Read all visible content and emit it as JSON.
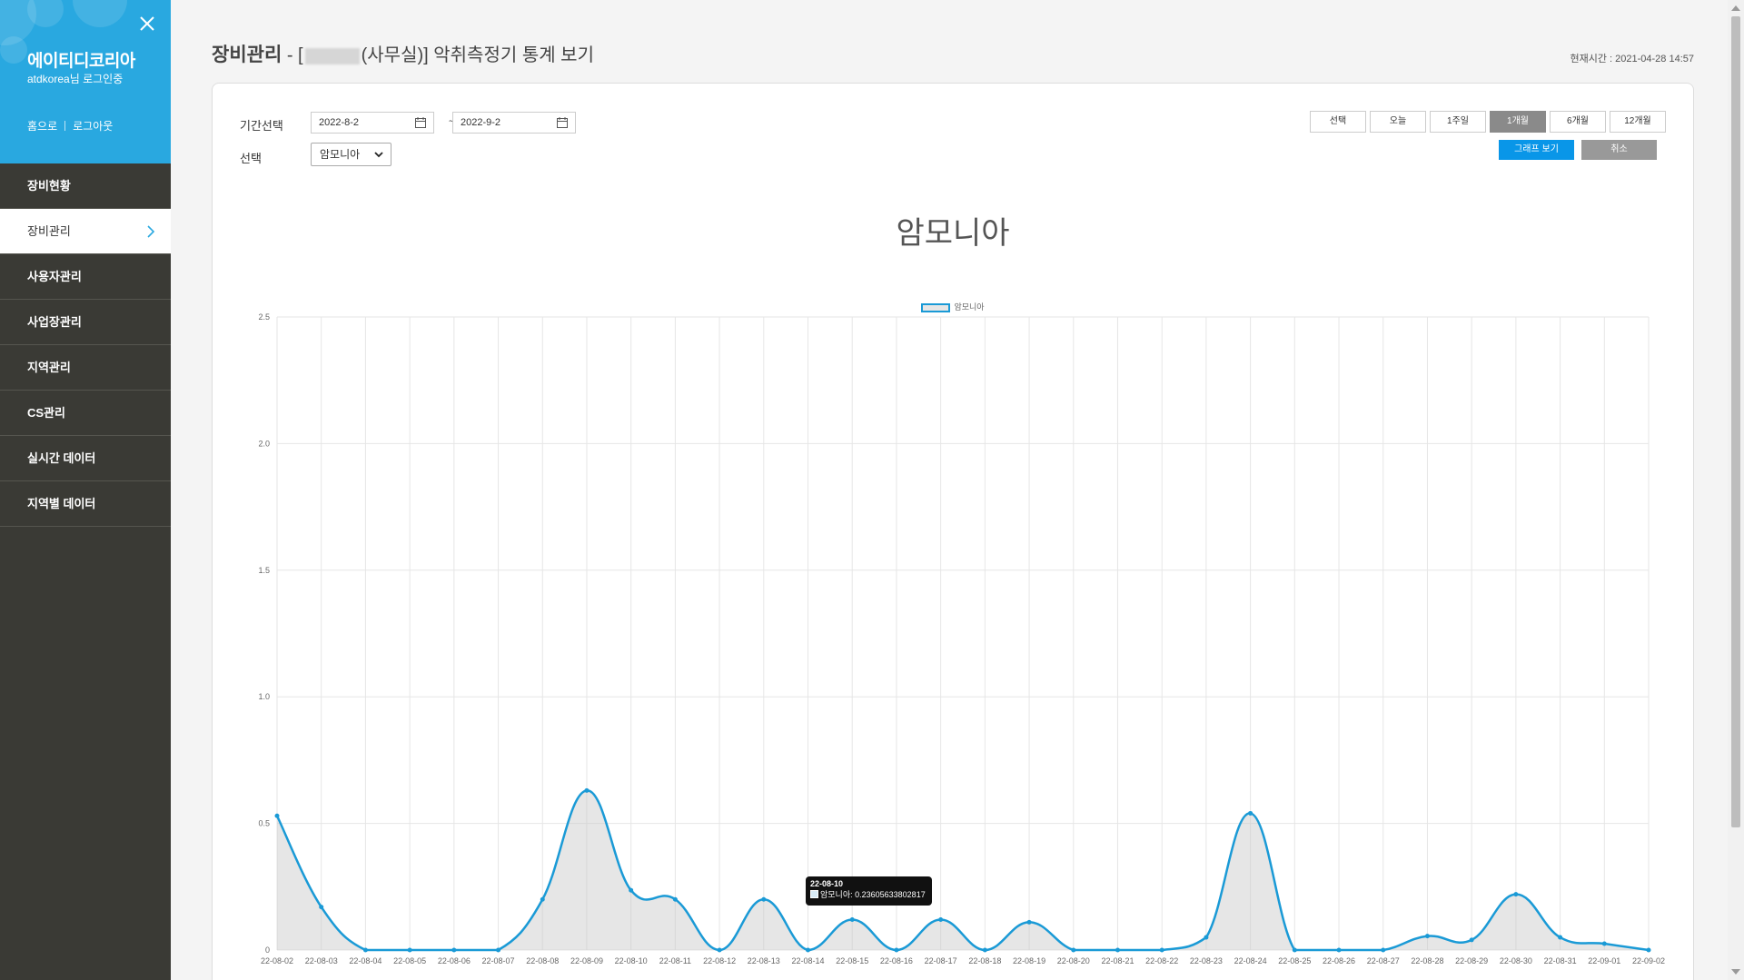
{
  "sidebar": {
    "brand": "에이티디코리아",
    "login_info": "atdkorea님 로그인중",
    "links": [
      "홈으로",
      "로그아웃"
    ],
    "items": [
      {
        "label": "장비현황",
        "active": false
      },
      {
        "label": "장비관리",
        "active": true
      },
      {
        "label": "사용자관리",
        "active": false
      },
      {
        "label": "사업장관리",
        "active": false
      },
      {
        "label": "지역관리",
        "active": false
      },
      {
        "label": "CS관리",
        "active": false
      },
      {
        "label": "실시간 데이터",
        "active": false
      },
      {
        "label": "지역별 데이터",
        "active": false
      }
    ]
  },
  "header": {
    "title_strong": "장비관리",
    "title_prefix": " - [",
    "title_suffix": "(사무실)] 악취측정기 통계 보기",
    "clock": "현재시간 : 2021-04-28 14:57"
  },
  "filter": {
    "period_label": "기간선택",
    "start_date": "2022-8-2",
    "tilde": "~",
    "end_date": "2022-9-2",
    "select_label": "선택",
    "select_value": "암모니아",
    "range_buttons": [
      "선택",
      "오늘",
      "1주일",
      "1개월",
      "6개월",
      "12개월"
    ],
    "active_range": "1개월",
    "graph_button": "그래프 보기",
    "cancel_button": "취소"
  },
  "tooltip": {
    "title": "22-08-10",
    "body": "암모니아: 0.23605633802817"
  },
  "colors": {
    "accent": "#29a8e0",
    "line": "#1a9ad6",
    "sidebar": "#3a3a35"
  },
  "chart_data": {
    "type": "line",
    "title": "암모니아",
    "series": [
      {
        "name": "암모니아",
        "values": [
          0.53,
          0.17,
          0,
          0,
          0,
          0,
          0.2,
          0.63,
          0.236,
          0.2,
          0,
          0.2,
          0,
          0.12,
          0,
          0.12,
          0,
          0.11,
          0,
          0,
          0,
          0.05,
          0.54,
          0,
          0,
          0,
          0.055,
          0.04,
          0.22,
          0.05,
          0.025,
          0
        ]
      }
    ],
    "categories": [
      "22-08-02",
      "22-08-03",
      "22-08-04",
      "22-08-05",
      "22-08-06",
      "22-08-07",
      "22-08-08",
      "22-08-09",
      "22-08-10",
      "22-08-11",
      "22-08-12",
      "22-08-13",
      "22-08-14",
      "22-08-15",
      "22-08-16",
      "22-08-17",
      "22-08-18",
      "22-08-19",
      "22-08-20",
      "22-08-21",
      "22-08-22",
      "22-08-23",
      "22-08-24",
      "22-08-25",
      "22-08-26",
      "22-08-27",
      "22-08-28",
      "22-08-29",
      "22-08-30",
      "22-08-31",
      "22-09-01",
      "22-09-02"
    ],
    "yticks": [
      "2.5",
      "2.0",
      "1.5",
      "1.0",
      "0.5",
      "0"
    ],
    "ylim": [
      0,
      2.5
    ],
    "grid": true,
    "legend_position": "top-center"
  }
}
